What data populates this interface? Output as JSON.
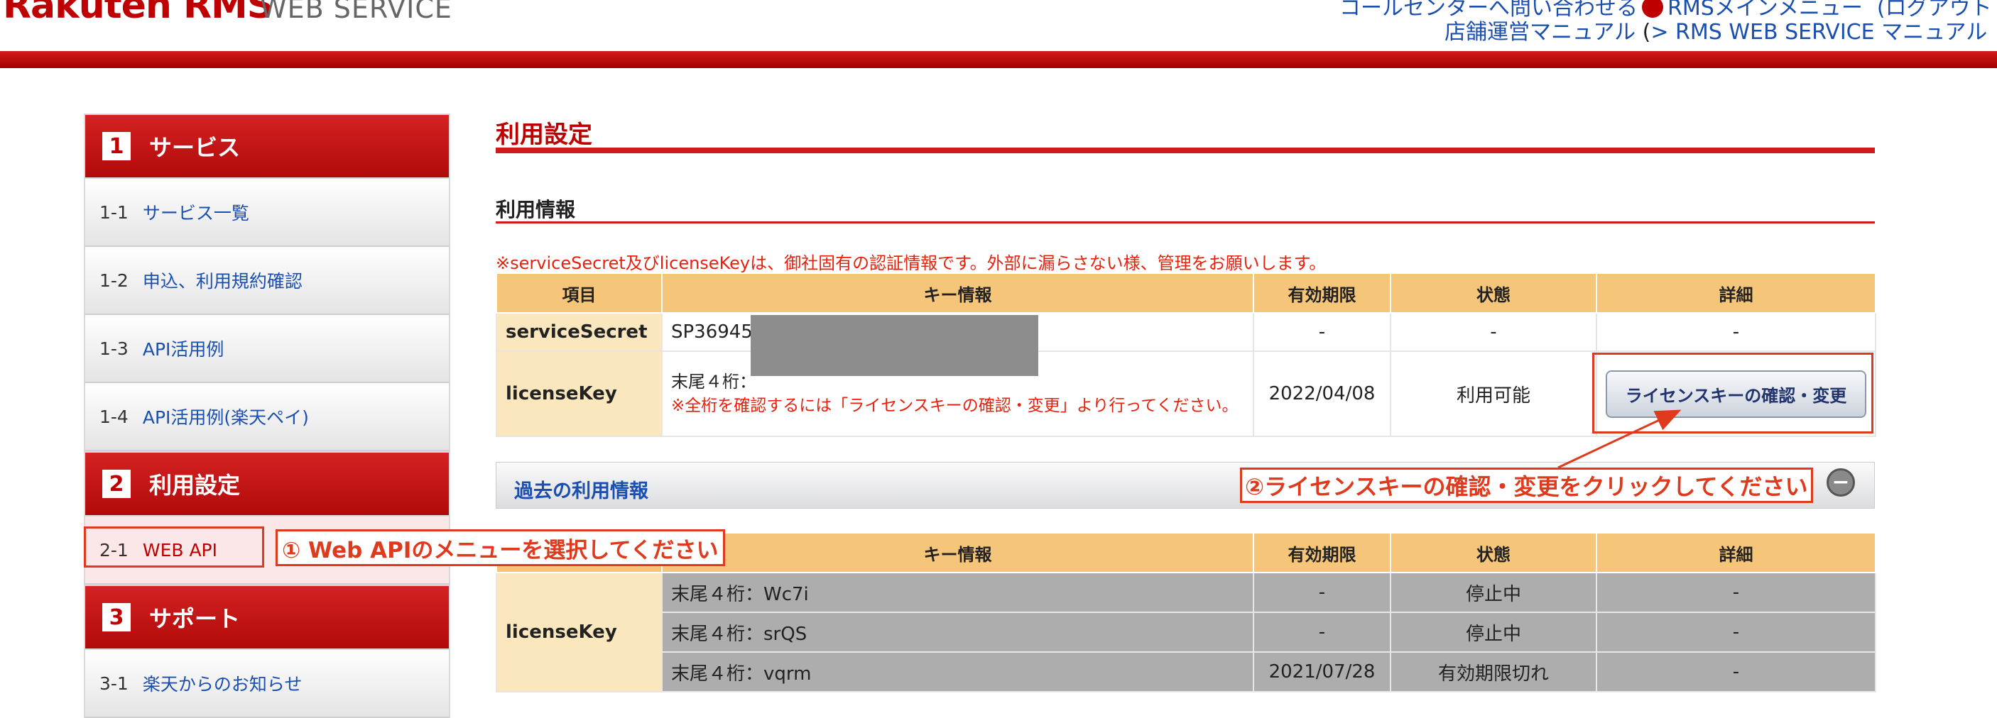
{
  "header": {
    "logo": "Rakuten RMS",
    "logo_sub": "WEB SERVICE",
    "links_top": "コールセンターへ問い合わせる",
    "rms_menu": "RMSメインメニュー",
    "logout": "(ログアウト",
    "manual": "店舗運営マニュアル",
    "manual_paren": "(",
    "webservice_manual": "> RMS WEB SERVICE マニュアル"
  },
  "sidebar": {
    "sections": [
      {
        "num": "1",
        "title": "サービス"
      },
      {
        "num": "2",
        "title": "利用設定"
      },
      {
        "num": "3",
        "title": "サポート"
      }
    ],
    "items": [
      {
        "num": "1-1",
        "label": "サービス一覧"
      },
      {
        "num": "1-2",
        "label": "申込、利用規約確認"
      },
      {
        "num": "1-3",
        "label": "API活用例"
      },
      {
        "num": "1-4",
        "label": "API活用例(楽天ペイ)"
      },
      {
        "num": "2-1",
        "label": "WEB API"
      },
      {
        "num": "3-1",
        "label": "楽天からのお知らせ"
      }
    ]
  },
  "annotations": {
    "step1": "① Web APIのメニューを選択してください",
    "step2": "②ライセンスキーの確認・変更をクリックしてください"
  },
  "main": {
    "page_title": "利用設定",
    "section_title": "利用情報",
    "notice": "※serviceSecret及びlicenseKeyは、御社固有の認証情報です。外部に漏らさない様、管理をお願いします。",
    "columns": [
      "項目",
      "キー情報",
      "有効期限",
      "状態",
      "詳細"
    ],
    "rows": {
      "service_secret": {
        "label": "serviceSecret",
        "key": "SP36945",
        "expiry": "-",
        "status": "-",
        "detail": "-"
      },
      "license_key": {
        "label": "licenseKey",
        "key_prefix": "末尾４桁：",
        "key_note": "※全桁を確認するには「ライセンスキーの確認・変更」より行ってください。",
        "expiry": "2022/04/08",
        "status": "利用可能",
        "button": "ライセンスキーの確認・変更"
      }
    },
    "past_title": "過去の利用情報",
    "past_columns": [
      "キー情報",
      "有効期限",
      "状態",
      "詳細"
    ],
    "past_label": "licenseKey",
    "past_rows": [
      {
        "key": "末尾４桁：Wc7i",
        "expiry": "-",
        "status": "停止中",
        "detail": "-"
      },
      {
        "key": "末尾４桁：srQS",
        "expiry": "-",
        "status": "停止中",
        "detail": "-"
      },
      {
        "key": "末尾４桁：vqrm",
        "expiry": "2021/07/28",
        "status": "有効期限切れ",
        "detail": "-"
      }
    ]
  },
  "colors": {
    "brand_red": "#bf0000",
    "annotation_red": "#e03a1e",
    "link_blue": "#1a4fb0",
    "table_header": "#f5c57a"
  }
}
